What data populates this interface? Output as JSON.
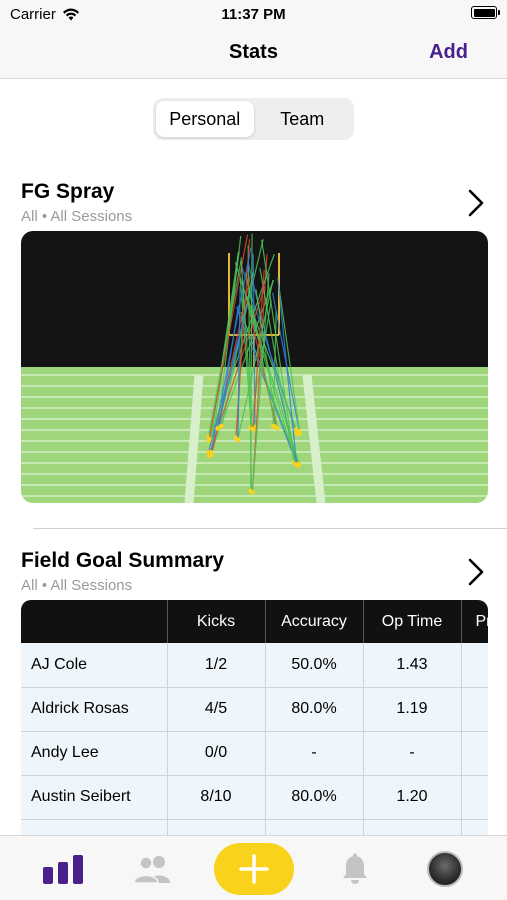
{
  "status_bar": {
    "carrier": "Carrier",
    "time": "11:37 PM"
  },
  "nav": {
    "title": "Stats",
    "add_label": "Add"
  },
  "segmented": {
    "options": [
      "Personal",
      "Team"
    ],
    "selected": "Personal"
  },
  "fg_spray": {
    "title": "FG Spray",
    "subtitle": "All • All Sessions"
  },
  "summary": {
    "title": "Field Goal Summary",
    "subtitle": "All • All Sessions",
    "columns": [
      "",
      "Kicks",
      "Accuracy",
      "Op Time",
      "Pr"
    ],
    "rows": [
      {
        "name": "AJ Cole",
        "kicks": "1/2",
        "accuracy": "50.0%",
        "op_time": "1.43"
      },
      {
        "name": "Aldrick Rosas",
        "kicks": "4/5",
        "accuracy": "80.0%",
        "op_time": "1.19"
      },
      {
        "name": "Andy Lee",
        "kicks": "0/0",
        "accuracy": "-",
        "op_time": "-"
      },
      {
        "name": "Austin Seibert",
        "kicks": "8/10",
        "accuracy": "80.0%",
        "op_time": "1.20"
      }
    ]
  },
  "tab_bar": {
    "items": [
      "stats-icon",
      "team-icon",
      "add-icon",
      "notifications-icon",
      "profile-avatar"
    ],
    "active": "stats-icon"
  },
  "colors": {
    "accent": "#4b1f8c",
    "fab": "#f9d21b",
    "turf": "#9fd67c",
    "sky": "#141414",
    "goal_post": "#e3b72f",
    "kick_green": "#4fc15a",
    "kick_blue": "#2f7fd6",
    "kick_red": "#d9492f"
  }
}
